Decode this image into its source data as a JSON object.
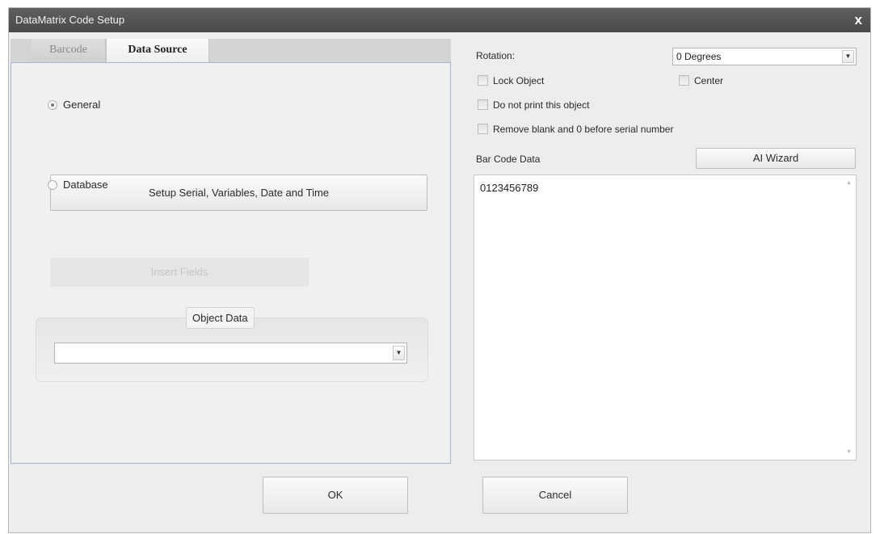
{
  "window": {
    "title": "DataMatrix Code Setup",
    "close_symbol": "x"
  },
  "tabs": [
    {
      "label": "Barcode",
      "active": false
    },
    {
      "label": "Data Source",
      "active": true
    }
  ],
  "data_source": {
    "general_label": "General",
    "general_selected": true,
    "setup_button": "Setup Serial, Variables, Date and Time",
    "database_label": "Database",
    "database_selected": false,
    "insert_fields_button": "Insert Fields",
    "object_data_label": "Object Data",
    "object_data_value": ""
  },
  "right_panel": {
    "rotation_label": "Rotation:",
    "rotation_value": "0 Degrees",
    "lock_object_label": "Lock Object",
    "lock_object_checked": false,
    "center_label": "Center",
    "center_checked": false,
    "do_not_print_label": "Do not print this object",
    "do_not_print_checked": false,
    "remove_blank_label": "Remove blank and 0 before serial number",
    "remove_blank_checked": false,
    "bar_code_data_label": "Bar Code Data",
    "ai_wizard_button": "AI Wizard",
    "bar_code_data_value": "0123456789"
  },
  "footer": {
    "ok_label": "OK",
    "cancel_label": "Cancel"
  },
  "colors": {
    "titlebar": "#555555",
    "panel_border": "#a8b6cf",
    "background": "#ededed"
  }
}
